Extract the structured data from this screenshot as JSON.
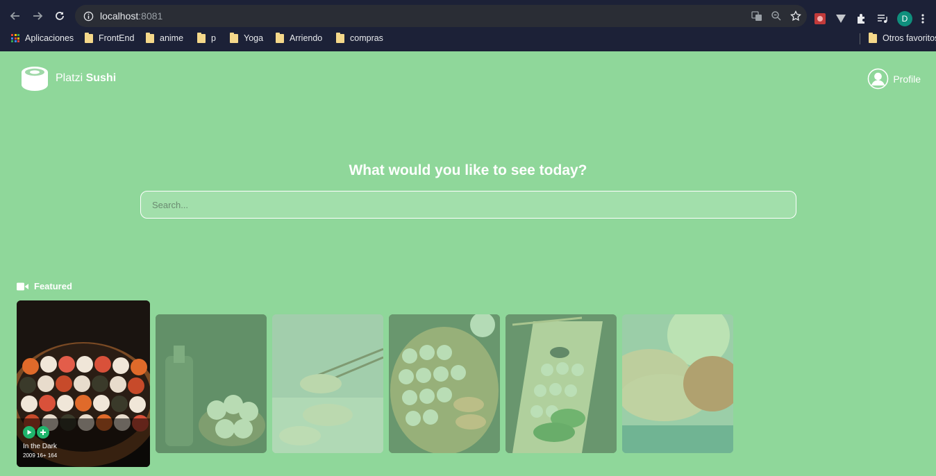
{
  "browser": {
    "url_host": "localhost",
    "url_port": ":8081",
    "profile_initial": "D",
    "bookmarks": [
      {
        "label": "Aplicaciones",
        "icon": "apps-grid-icon"
      },
      {
        "label": "FrontEnd",
        "icon": "folder-icon"
      },
      {
        "label": "anime",
        "icon": "folder-icon"
      },
      {
        "label": "p",
        "icon": "folder-icon"
      },
      {
        "label": "Yoga",
        "icon": "folder-icon"
      },
      {
        "label": "Arriendo",
        "icon": "folder-icon"
      },
      {
        "label": "compras",
        "icon": "folder-icon"
      }
    ],
    "other_bookmarks": "Otros favoritos"
  },
  "header": {
    "brand_light": "Platzi",
    "brand_bold": "Sushi",
    "profile_label": "Profile"
  },
  "hero": {
    "title": "What would you like to see today?",
    "search_placeholder": "Search..."
  },
  "featured": {
    "title": "Featured",
    "items": [
      {
        "title": "In the Dark",
        "subtitle": "2009 16+ 164",
        "image": "sushi-platter"
      },
      {
        "image": "sake-and-rolls"
      },
      {
        "image": "nigiri-chopsticks"
      },
      {
        "image": "sushi-board"
      },
      {
        "image": "sushi-long-board"
      },
      {
        "image": "salmon-sashimi"
      }
    ]
  },
  "colors": {
    "page_background": "#8fd79a",
    "browser_chrome": "#1c2137",
    "accent_green": "#1fb56c"
  }
}
